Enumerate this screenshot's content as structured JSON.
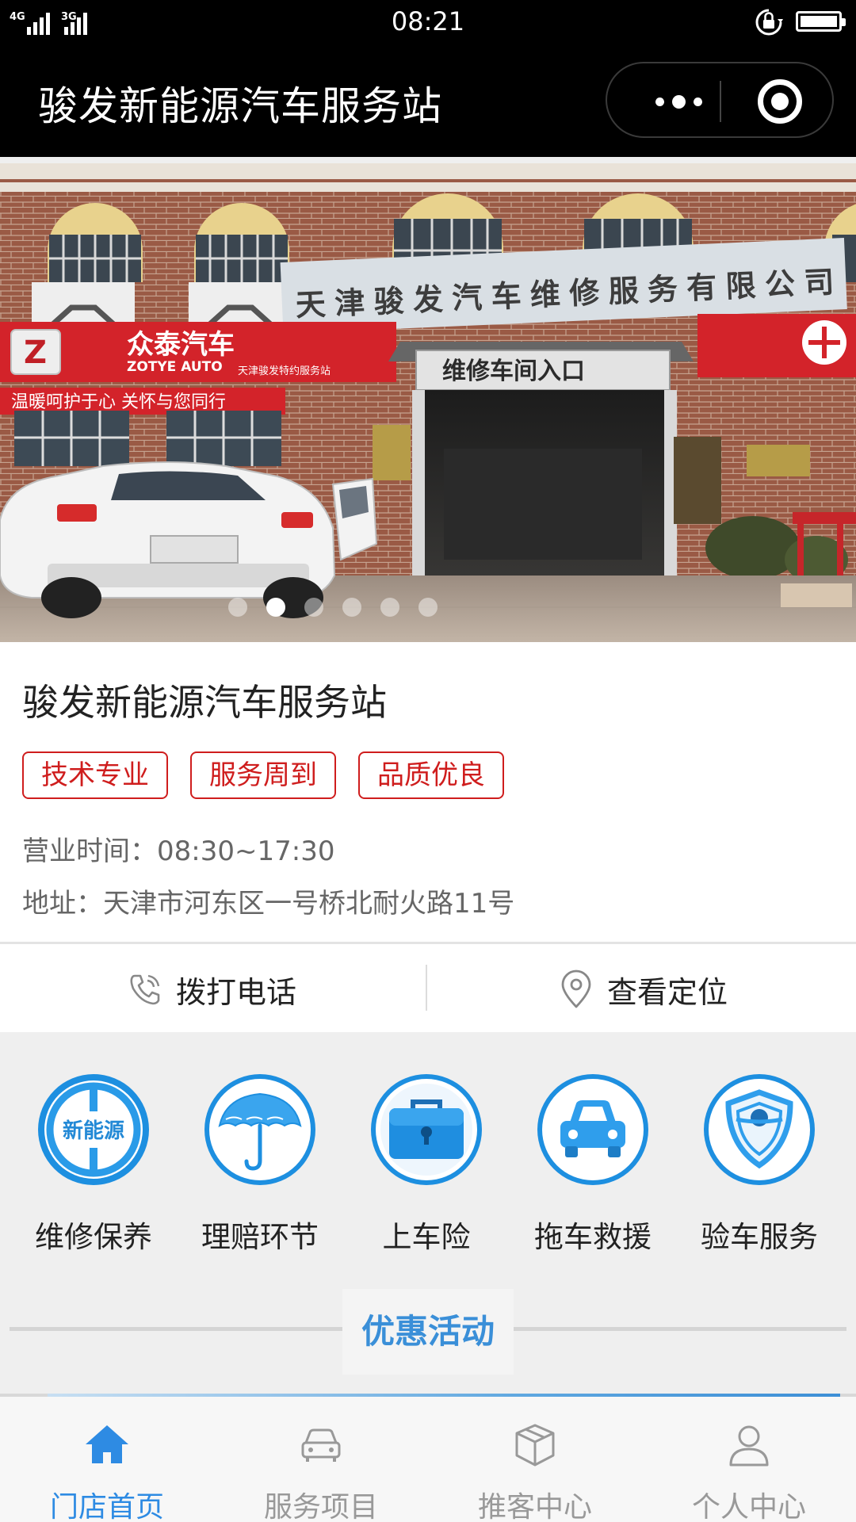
{
  "status_bar": {
    "time": "08:21",
    "network_1": "4G",
    "network_2": "3G"
  },
  "nav": {
    "title": "骏发新能源汽车服务站"
  },
  "banner": {
    "sign_main": "天津骏发汽车维修服务有限公司",
    "sign_entrance": "维修车间入口",
    "sign_brand": "众泰汽车",
    "sign_brand_en": "ZOTYE AUTO",
    "sign_dealer": "天津骏发特约服务站",
    "sign_slogan": "温暖呵护于心  关怀与您同行",
    "slide_count": 6,
    "active_slide_index": 1
  },
  "store": {
    "name": "骏发新能源汽车服务站",
    "tags": [
      "技术专业",
      "服务周到",
      "品质优良"
    ],
    "hours": "营业时间：08:30~17:30",
    "address": "地址：天津市河东区一号桥北耐火路11号"
  },
  "actions": {
    "call_label": "拨打电话",
    "location_label": "查看定位"
  },
  "services": [
    {
      "label": "维修保养",
      "icon": "new-energy-steering-wheel-icon",
      "icon_text": "新能源"
    },
    {
      "label": "理赔环节",
      "icon": "umbrella-icon"
    },
    {
      "label": "上车险",
      "icon": "briefcase-icon"
    },
    {
      "label": "拖车救援",
      "icon": "car-icon"
    },
    {
      "label": "验车服务",
      "icon": "shield-icon"
    }
  ],
  "promo": {
    "title": "优惠活动"
  },
  "tabbar": {
    "items": [
      {
        "label": "门店首页",
        "icon": "home-icon",
        "active": true
      },
      {
        "label": "服务项目",
        "icon": "car-outline-icon",
        "active": false
      },
      {
        "label": "推客中心",
        "icon": "box-icon",
        "active": false
      },
      {
        "label": "个人中心",
        "icon": "user-icon",
        "active": false
      }
    ]
  },
  "colors": {
    "accent_blue": "#2e8be3",
    "tag_red": "#cf1d1d",
    "promo_blue": "#3a8fd8"
  }
}
